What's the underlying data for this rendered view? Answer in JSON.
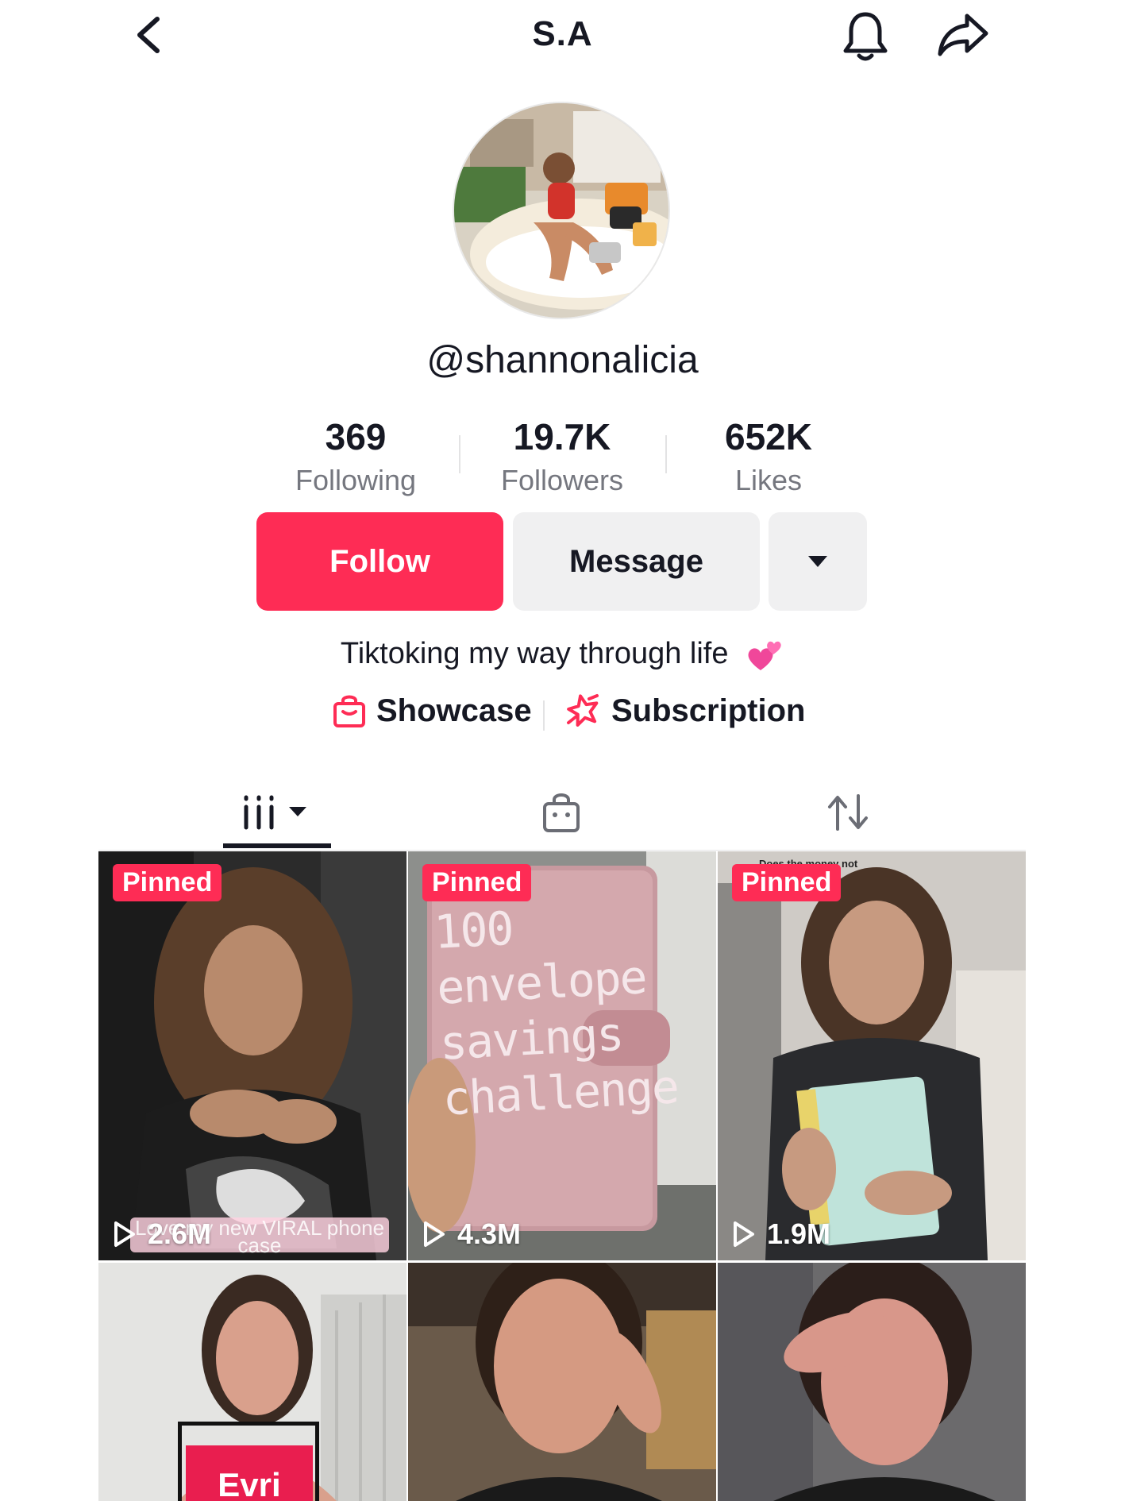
{
  "header": {
    "title": "S.A",
    "back_icon": "chevron-left-icon",
    "bell_icon": "bell-icon",
    "share_icon": "share-arrow-icon"
  },
  "profile": {
    "username": "@shannonalicia",
    "bio": "Tiktoking my way through life",
    "bio_emoji": "two-hearts-emoji"
  },
  "stats": [
    {
      "value": "369",
      "label": "Following"
    },
    {
      "value": "19.7K",
      "label": "Followers"
    },
    {
      "value": "652K",
      "label": "Likes"
    }
  ],
  "actions": {
    "follow_label": "Follow",
    "message_label": "Message",
    "more_icon": "caret-down-icon"
  },
  "links": [
    {
      "label": "Showcase",
      "icon": "shopping-bag-icon"
    },
    {
      "label": "Subscription",
      "icon": "star-badge-icon"
    }
  ],
  "tabs": [
    {
      "name": "videos",
      "icon": "grid-videos-icon",
      "active": true
    },
    {
      "name": "shop",
      "icon": "shopping-bag-icon",
      "active": false
    },
    {
      "name": "reposts",
      "icon": "repost-icon",
      "active": false
    }
  ],
  "videos": [
    {
      "pinned_label": "Pinned",
      "views": "2.6M",
      "caption": "Love my new VIRAL phone case"
    },
    {
      "pinned_label": "Pinned",
      "views": "4.3M",
      "book_text": "100 envelope savings challenge"
    },
    {
      "pinned_label": "Pinned",
      "views": "1.9M",
      "comment_text": "Does the money not"
    },
    {
      "sticker_text": "Evri"
    },
    {},
    {}
  ],
  "colors": {
    "accent": "#fe2c55",
    "secondary_button": "#f0f0f1",
    "text_primary": "#161823",
    "text_secondary": "#75777f"
  }
}
